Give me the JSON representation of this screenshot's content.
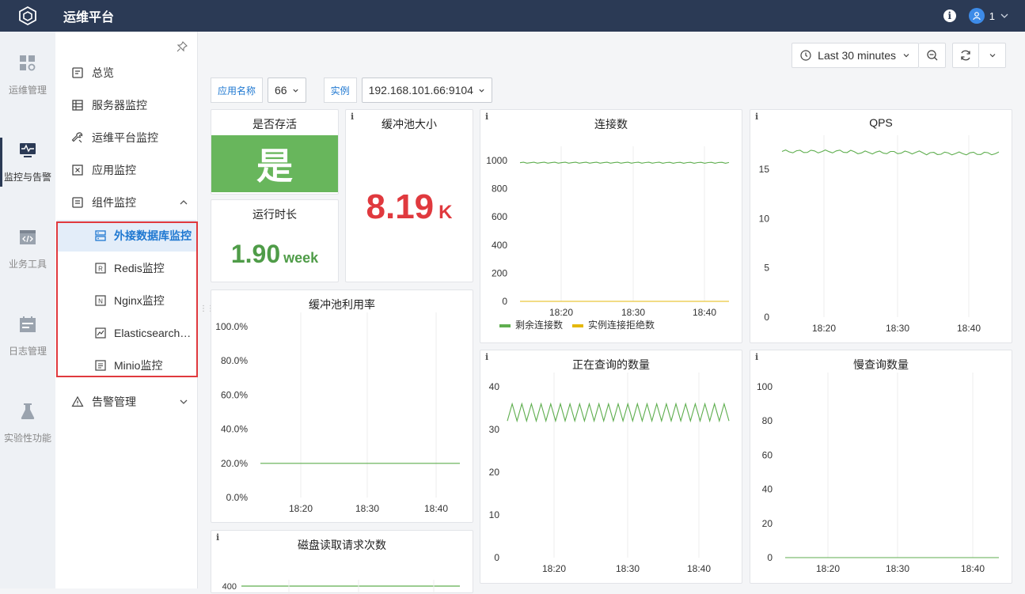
{
  "app": {
    "title": "运维平台"
  },
  "user": {
    "name": "1"
  },
  "rail": [
    {
      "label": "运维管理",
      "icon": "dashboard-grid-icon"
    },
    {
      "label": "监控与告警",
      "icon": "monitor-icon"
    },
    {
      "label": "业务工具",
      "icon": "code-window-icon"
    },
    {
      "label": "日志管理",
      "icon": "calendar-icon"
    },
    {
      "label": "实验性功能",
      "icon": "flask-icon"
    }
  ],
  "nav": {
    "items": [
      {
        "label": "总览",
        "icon": "overview-icon"
      },
      {
        "label": "服务器监控",
        "icon": "server-icon"
      },
      {
        "label": "运维平台监控",
        "icon": "wrench-icon"
      },
      {
        "label": "应用监控",
        "icon": "app-icon"
      },
      {
        "label": "组件监控",
        "icon": "component-icon"
      }
    ],
    "sub_items": [
      {
        "label": "外接数据库监控",
        "icon": "database-icon"
      },
      {
        "label": "Redis监控",
        "icon": "redis-icon"
      },
      {
        "label": "Nginx监控",
        "icon": "nginx-icon"
      },
      {
        "label": "Elasticsearch监控",
        "icon": "elasticsearch-icon"
      },
      {
        "label": "Minio监控",
        "icon": "minio-icon"
      }
    ],
    "alert": {
      "label": "告警管理",
      "icon": "alert-icon"
    }
  },
  "toolbar": {
    "time_range": "Last 30 minutes"
  },
  "vars": {
    "app_label": "应用名称",
    "app_value": "66",
    "instance_label": "实例",
    "instance_value": "192.168.101.66:9104"
  },
  "panels": {
    "alive": {
      "title": "是否存活",
      "value": "是"
    },
    "uptime": {
      "title": "运行时长",
      "value": "1.90",
      "unit": "week"
    },
    "pool_size": {
      "title": "缓冲池大小",
      "value": "8.19",
      "unit": "K"
    },
    "pool_usage": {
      "title": "缓冲池利用率"
    },
    "disk_reads": {
      "title": "磁盘读取请求次数"
    },
    "connections": {
      "title": "连接数"
    },
    "qps": {
      "title": "QPS"
    },
    "running_queries": {
      "title": "正在查询的数量"
    },
    "slow_queries": {
      "title": "慢查询数量"
    }
  },
  "colors": {
    "green": "#5fae4f",
    "yellow": "#e5b80b",
    "red": "#e0393e",
    "topbar": "#2b3a55"
  },
  "chart_data": [
    {
      "id": "connections",
      "type": "line",
      "title": "连接数",
      "x": [
        "18:20",
        "18:30",
        "18:40"
      ],
      "ylim": [
        0,
        1000
      ],
      "yticks": [
        "1000",
        "800",
        "600",
        "400",
        "200",
        "0"
      ],
      "series": [
        {
          "name": "剩余连接数",
          "color": "#5fae4f",
          "values": [
            985,
            985,
            985
          ]
        },
        {
          "name": "实例连接拒绝数",
          "color": "#e5b80b",
          "values": [
            0,
            0,
            0
          ]
        }
      ],
      "legend": "bottom"
    },
    {
      "id": "qps",
      "type": "line",
      "title": "QPS",
      "x": [
        "18:20",
        "18:30",
        "18:40"
      ],
      "ylim": [
        0,
        17
      ],
      "yticks": [
        "15",
        "10",
        "5",
        "0"
      ],
      "series": [
        {
          "color": "#5fae4f",
          "values": [
            16.8,
            16.7,
            16.6
          ]
        }
      ]
    },
    {
      "id": "pool_usage",
      "type": "line",
      "title": "缓冲池利用率",
      "x": [
        "18:20",
        "18:30",
        "18:40"
      ],
      "ylim": [
        0,
        100
      ],
      "yticks": [
        "100.0%",
        "80.0%",
        "60.0%",
        "40.0%",
        "20.0%",
        "0.0%"
      ],
      "series": [
        {
          "color": "#5fae4f",
          "values": [
            20,
            20,
            20
          ]
        }
      ]
    },
    {
      "id": "running_queries",
      "type": "line",
      "title": "正在查询的数量",
      "x": [
        "18:20",
        "18:30",
        "18:40"
      ],
      "ylim": [
        0,
        40
      ],
      "yticks": [
        "40",
        "30",
        "20",
        "10",
        "0"
      ],
      "series": [
        {
          "color": "#5fae4f",
          "values": [
            32,
            36,
            32,
            36
          ]
        }
      ]
    },
    {
      "id": "slow_queries",
      "type": "line",
      "title": "慢查询数量",
      "x": [
        "18:20",
        "18:30",
        "18:40"
      ],
      "ylim": [
        0,
        100
      ],
      "yticks": [
        "100",
        "80",
        "60",
        "40",
        "20",
        "0"
      ],
      "series": [
        {
          "color": "#5fae4f",
          "values": [
            0,
            0,
            0
          ]
        }
      ]
    },
    {
      "id": "disk_reads",
      "type": "line",
      "title": "磁盘读取请求次数",
      "yticks": [
        "400"
      ],
      "series": [
        {
          "color": "#5fae4f",
          "values": [
            400,
            400
          ]
        }
      ]
    }
  ]
}
